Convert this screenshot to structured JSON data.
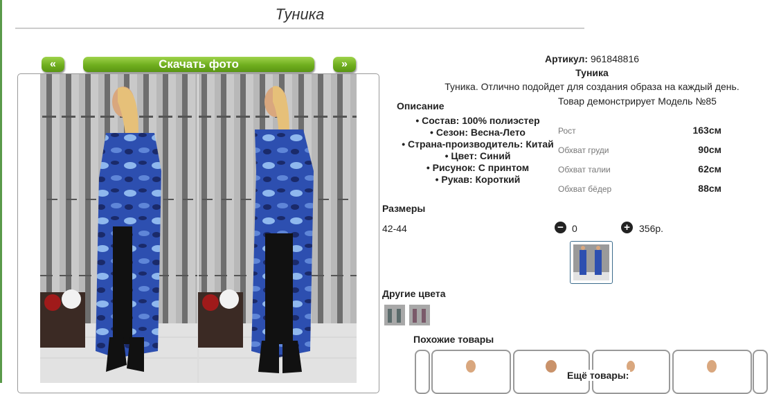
{
  "page": {
    "title": "Туника"
  },
  "gallery": {
    "prev_label": "«",
    "download_label": "Скачать фото",
    "next_label": "»"
  },
  "product": {
    "article_label": "Артикул:",
    "article_value": "961848816",
    "name": "Туника",
    "description": "Туника. Отлично подойдет для создания образа на каждый день."
  },
  "description_section": {
    "heading": "Описание",
    "properties": [
      "Состав: 100% полиэстер",
      "Сезон: Весна-Лето",
      "Страна-производитель: Китай",
      "Цвет: Синий",
      "Рисунок: С принтом",
      "Рукав: Короткий"
    ]
  },
  "model": {
    "title": "Товар демонстрирует Модель №85",
    "measurements": [
      {
        "label": "Рост",
        "value": "163см"
      },
      {
        "label": "Обхват груди",
        "value": "90см"
      },
      {
        "label": "Обхват талии",
        "value": "62см"
      },
      {
        "label": "Обхват бёдер",
        "value": "88см"
      }
    ]
  },
  "sizes": {
    "heading": "Размеры",
    "rows": [
      {
        "size": "42-44",
        "quantity": "0",
        "price": "356р."
      }
    ]
  },
  "other_colors": {
    "heading": "Другие цвета"
  },
  "similar": {
    "heading": "Похожие товары",
    "more_label": "Ещё товары:"
  },
  "colors": {
    "accent_green": "#6fae1e",
    "camo_blue": "#2d4fb0",
    "camo_light": "#8fb8ee",
    "wood": "#8a8a8a"
  },
  "icons": {
    "minus": "minus-circle-icon",
    "plus": "plus-circle-icon"
  }
}
